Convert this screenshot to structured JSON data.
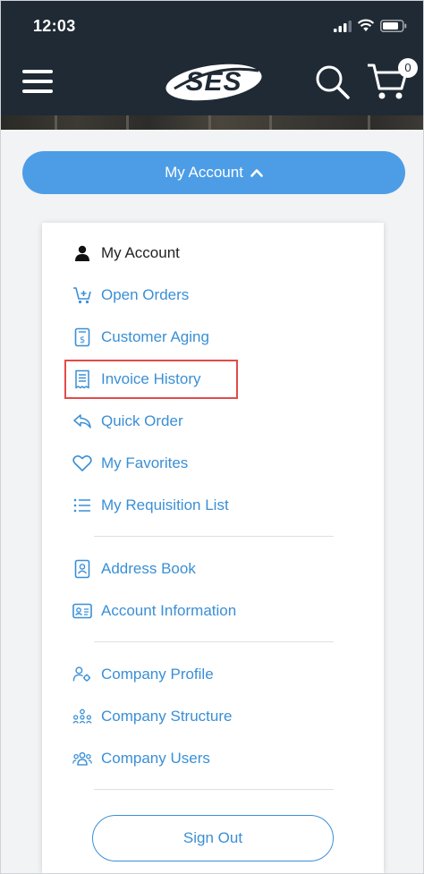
{
  "status_bar": {
    "time": "12:03"
  },
  "header": {
    "logo_text": "SES",
    "cart_count": "0"
  },
  "account_toggle": {
    "label": "My Account"
  },
  "menu": {
    "items": [
      {
        "label": "My Account",
        "icon": "user-icon",
        "active": true
      },
      {
        "label": "Open Orders",
        "icon": "cart-plus-icon"
      },
      {
        "label": "Customer Aging",
        "icon": "dollar-document-icon"
      },
      {
        "label": "Invoice History",
        "icon": "receipt-icon",
        "highlighted": true
      },
      {
        "label": "Quick Order",
        "icon": "reply-arrow-icon"
      },
      {
        "label": "My Favorites",
        "icon": "heart-icon"
      },
      {
        "label": "My Requisition List",
        "icon": "list-icon"
      },
      {
        "label": "Address Book",
        "icon": "address-book-icon"
      },
      {
        "label": "Account Information",
        "icon": "id-card-icon"
      },
      {
        "label": "Company Profile",
        "icon": "user-gear-icon"
      },
      {
        "label": "Company Structure",
        "icon": "org-structure-icon"
      },
      {
        "label": "Company Users",
        "icon": "users-icon"
      }
    ]
  },
  "signout": {
    "label": "Sign Out"
  },
  "colors": {
    "header_bg": "#1f2a35",
    "accent_blue": "#4c9de6",
    "link_blue": "#3a8fd6",
    "highlight_red": "#e24b4b"
  }
}
